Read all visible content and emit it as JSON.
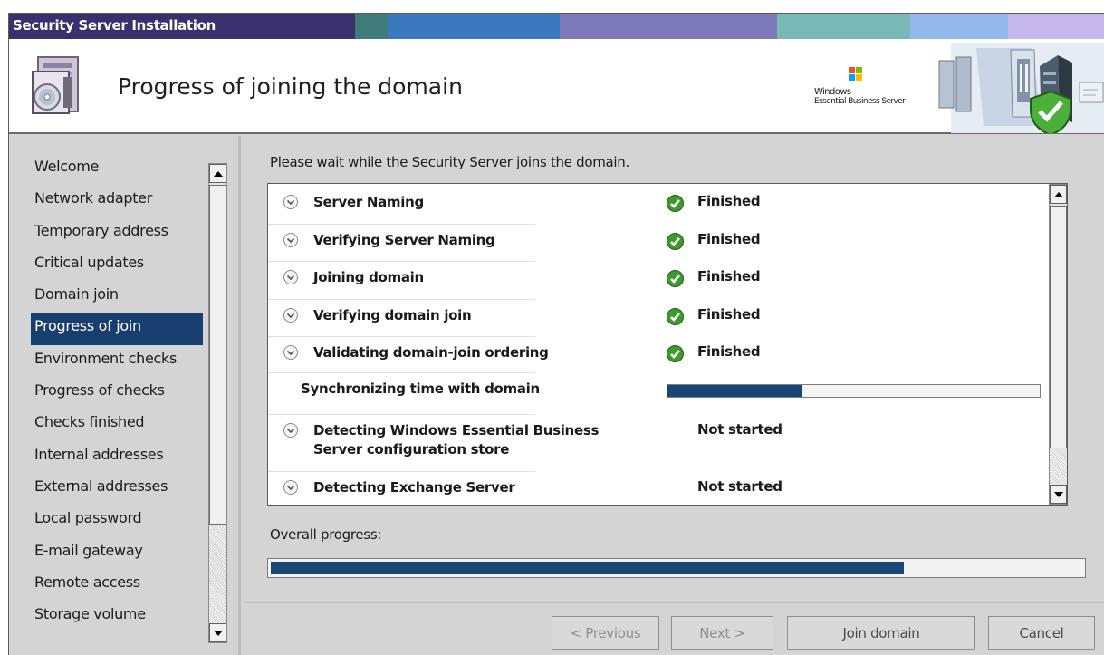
{
  "window": {
    "title": "Security Server Installation",
    "title_colors": [
      "#3a306d",
      "#4a3f7a",
      "#3f7b78",
      "#3b78be",
      "#7e79bb",
      "#7ab8b6",
      "#94b8ec",
      "#c5b7ec"
    ]
  },
  "header": {
    "page_title": "Progress of joining the domain",
    "brand_line1": "Windows",
    "brand_line2": "Essential Business Server"
  },
  "sidebar": {
    "items": [
      {
        "label": "Welcome",
        "active": false
      },
      {
        "label": "Network adapter",
        "active": false
      },
      {
        "label": "Temporary address",
        "active": false
      },
      {
        "label": "Critical updates",
        "active": false
      },
      {
        "label": "Domain join",
        "active": false
      },
      {
        "label": "Progress of join",
        "active": true
      },
      {
        "label": "Environment checks",
        "active": false
      },
      {
        "label": "Progress of checks",
        "active": false
      },
      {
        "label": "Checks finished",
        "active": false
      },
      {
        "label": "Internal addresses",
        "active": false
      },
      {
        "label": "External addresses",
        "active": false
      },
      {
        "label": "Local password",
        "active": false
      },
      {
        "label": "E-mail gateway",
        "active": false
      },
      {
        "label": "Remote access",
        "active": false
      },
      {
        "label": "Storage volume",
        "active": false
      }
    ]
  },
  "main": {
    "instruction": "Please wait while the Security Server joins the domain.",
    "steps": [
      {
        "name": "Server Naming",
        "status": "Finished",
        "state": "finished"
      },
      {
        "name": "Verifying Server Naming",
        "status": "Finished",
        "state": "finished"
      },
      {
        "name": "Joining domain",
        "status": "Finished",
        "state": "finished"
      },
      {
        "name": "Verifying domain join",
        "status": "Finished",
        "state": "finished"
      },
      {
        "name": "Validating domain-join ordering",
        "status": "Finished",
        "state": "finished"
      },
      {
        "name": "Synchronizing time with domain",
        "status": "",
        "state": "in-progress",
        "progress": 0.36
      },
      {
        "name_line1": "Detecting Windows Essential Business",
        "name_line2": "Server configuration store",
        "status": "Not started",
        "state": "not-started"
      },
      {
        "name": "Detecting Exchange Server",
        "status": "Not started",
        "state": "not-started"
      }
    ],
    "overall_label": "Overall progress:",
    "overall_progress": 0.78
  },
  "buttons": {
    "previous": "< Previous",
    "next": "Next >",
    "join": "Join domain",
    "cancel": "Cancel"
  },
  "icons": {
    "setup": "setup-wizard-icon",
    "check": "check-icon",
    "chevron": "chevron-down-icon",
    "scroll_up": "scroll-up-icon",
    "scroll_down": "scroll-down-icon"
  }
}
